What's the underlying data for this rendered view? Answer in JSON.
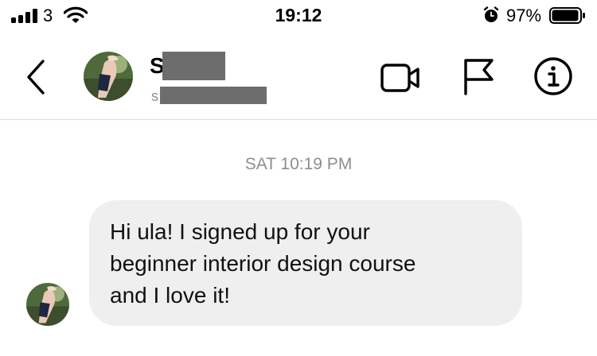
{
  "status_bar": {
    "carrier": "3",
    "time": "19:12",
    "battery_percent": "97%",
    "battery_level": 0.97,
    "icons": [
      "signal-icon",
      "wifi-icon",
      "alarm-icon",
      "battery-icon"
    ]
  },
  "header": {
    "contact_initial": "S",
    "contact_sub_initial": "s",
    "icons": [
      "back-chevron-icon",
      "video-camera-icon",
      "flag-icon",
      "info-icon"
    ]
  },
  "chat": {
    "timestamp": "SAT 10:19 PM",
    "messages": [
      {
        "lines": [
          "Hi ula! I signed up for your",
          "beginner interior design course",
          "and I love it!"
        ]
      }
    ]
  },
  "colors": {
    "bubble_bg": "#efefef",
    "timestamp": "#8e8e8e",
    "divider": "#dbdbdb",
    "redaction": "#6d6d6d"
  }
}
